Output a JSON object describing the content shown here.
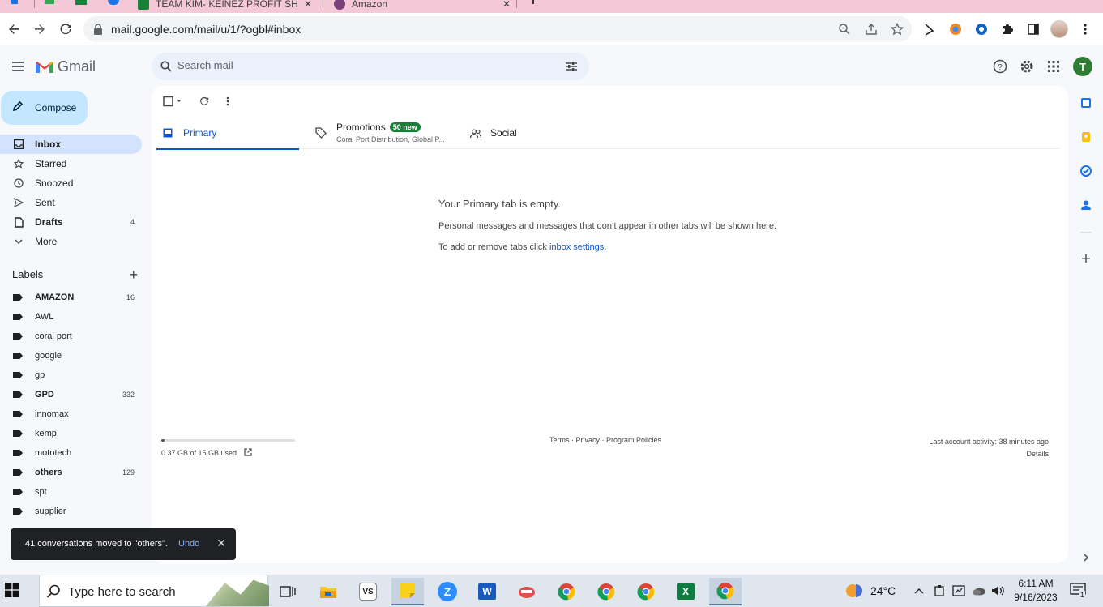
{
  "browser": {
    "tabs": [
      {
        "title": "TEAM KIM- KEINEZ PROFIT SHEET"
      },
      {
        "title": "Amazon"
      }
    ],
    "url": "mail.google.com/mail/u/1/?ogbl#inbox"
  },
  "gmail": {
    "logo_text": "Gmail",
    "search_placeholder": "Search mail",
    "avatar_letter": "T",
    "compose_label": "Compose",
    "nav": [
      {
        "label": "Inbox",
        "count": "",
        "icon": "inbox-icon",
        "active": true
      },
      {
        "label": "Starred",
        "count": "",
        "icon": "star-icon"
      },
      {
        "label": "Snoozed",
        "count": "",
        "icon": "clock-icon"
      },
      {
        "label": "Sent",
        "count": "",
        "icon": "send-icon"
      },
      {
        "label": "Drafts",
        "count": "4",
        "icon": "draft-icon"
      },
      {
        "label": "More",
        "count": "",
        "icon": "chevron-down-icon"
      }
    ],
    "labels_title": "Labels",
    "labels": [
      {
        "name": "AMAZON",
        "count": "16",
        "bold": true
      },
      {
        "name": "AWL",
        "count": ""
      },
      {
        "name": "coral port",
        "count": ""
      },
      {
        "name": "google",
        "count": ""
      },
      {
        "name": "gp",
        "count": ""
      },
      {
        "name": "GPD",
        "count": "332",
        "bold": true
      },
      {
        "name": "innomax",
        "count": ""
      },
      {
        "name": "kemp",
        "count": ""
      },
      {
        "name": "mototech",
        "count": ""
      },
      {
        "name": "others",
        "count": "129",
        "bold": true
      },
      {
        "name": "spt",
        "count": ""
      },
      {
        "name": "supplier",
        "count": ""
      }
    ],
    "tabs": {
      "primary": "Primary",
      "promotions": "Promotions",
      "promotions_badge": "50 new",
      "promotions_snippet": "Coral Port Distribution, Global P...",
      "social": "Social"
    },
    "empty": {
      "heading": "Your Primary tab is empty.",
      "line1": "Personal messages and messages that don’t appear in other tabs will be shown here.",
      "line2_prefix": "To add or remove tabs click ",
      "line2_link": "inbox settings",
      "line2_suffix": "."
    },
    "footer": {
      "storage_text": "0.37 GB of 15 GB used",
      "storage_fraction": 0.025,
      "links": "Terms · Privacy · Program Policies",
      "activity": "Last account activity: 38 minutes ago",
      "details": "Details"
    },
    "toast": {
      "message": "41 conversations moved to \"others\".",
      "undo": "Undo"
    }
  },
  "taskbar": {
    "search_text": "Type here to search",
    "weather": "24°C",
    "time": "6:11 AM",
    "date": "9/16/2023",
    "notification_count": "1"
  },
  "colors": {
    "accent": "#0b57d0",
    "compose_bg": "#c2e7ff",
    "active_nav": "#d3e3fd",
    "badge_green": "#188038",
    "tabstrip": "#f5c8d8"
  }
}
